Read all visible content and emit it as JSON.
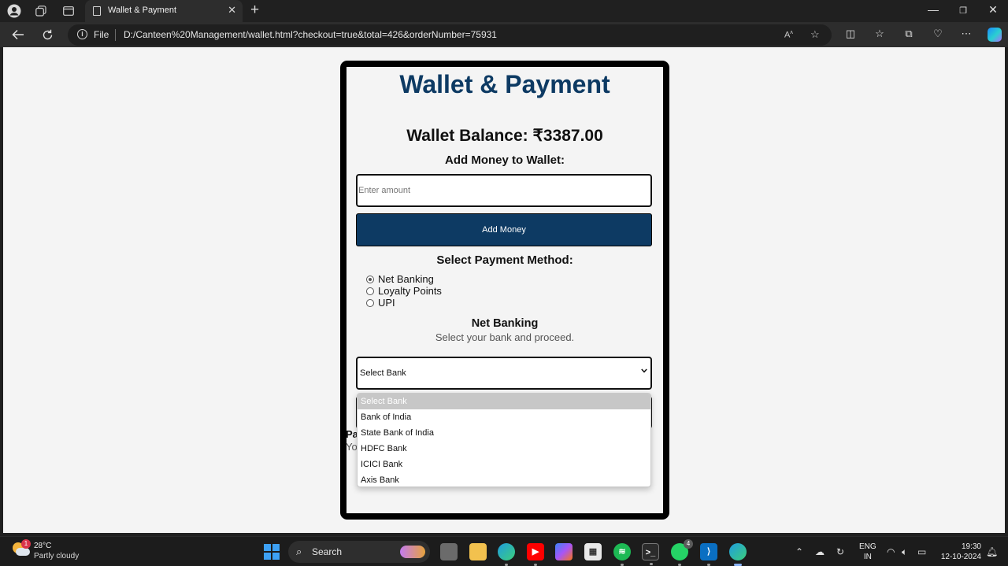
{
  "browser": {
    "tab_title": "Wallet & Payment",
    "new_tab_label": "+",
    "file_label": "File",
    "url": "D:/Canteen%20Management/wallet.html?checkout=true&total=426&orderNumber=75931"
  },
  "page": {
    "title": "Wallet & Payment",
    "wallet_balance": "Wallet Balance: ₹3387.00",
    "add_money_heading": "Add Money to Wallet:",
    "amount_placeholder": "Enter amount",
    "amount_value": "",
    "add_money_button": "Add Money",
    "payment_method_heading": "Select Payment Method:",
    "payment_methods": [
      {
        "label": "Net Banking",
        "selected": true
      },
      {
        "label": "Loyalty Points",
        "selected": false
      },
      {
        "label": "UPI",
        "selected": false
      }
    ],
    "net_banking_heading": "Net Banking",
    "net_banking_subtitle": "Select your bank and proceed.",
    "bank_select_value": "Select Bank",
    "obscured_heading_fragment": "Pa",
    "obscured_text_fragment": "Yo",
    "bank_options": [
      "Select Bank",
      "Bank of India",
      "State Bank of India",
      "HDFC Bank",
      "ICICI Bank",
      "Axis Bank"
    ]
  },
  "taskbar": {
    "weather_temp": "28°C",
    "weather_desc": "Partly cloudy",
    "weather_badge": "1",
    "search_label": "Search",
    "whatsapp_badge": "4",
    "lang_line1": "ENG",
    "lang_line2": "IN",
    "time": "19:30",
    "date": "12-10-2024"
  },
  "colors": {
    "brand_navy": "#0d3a63",
    "edge_active": "#8ab4f8"
  }
}
